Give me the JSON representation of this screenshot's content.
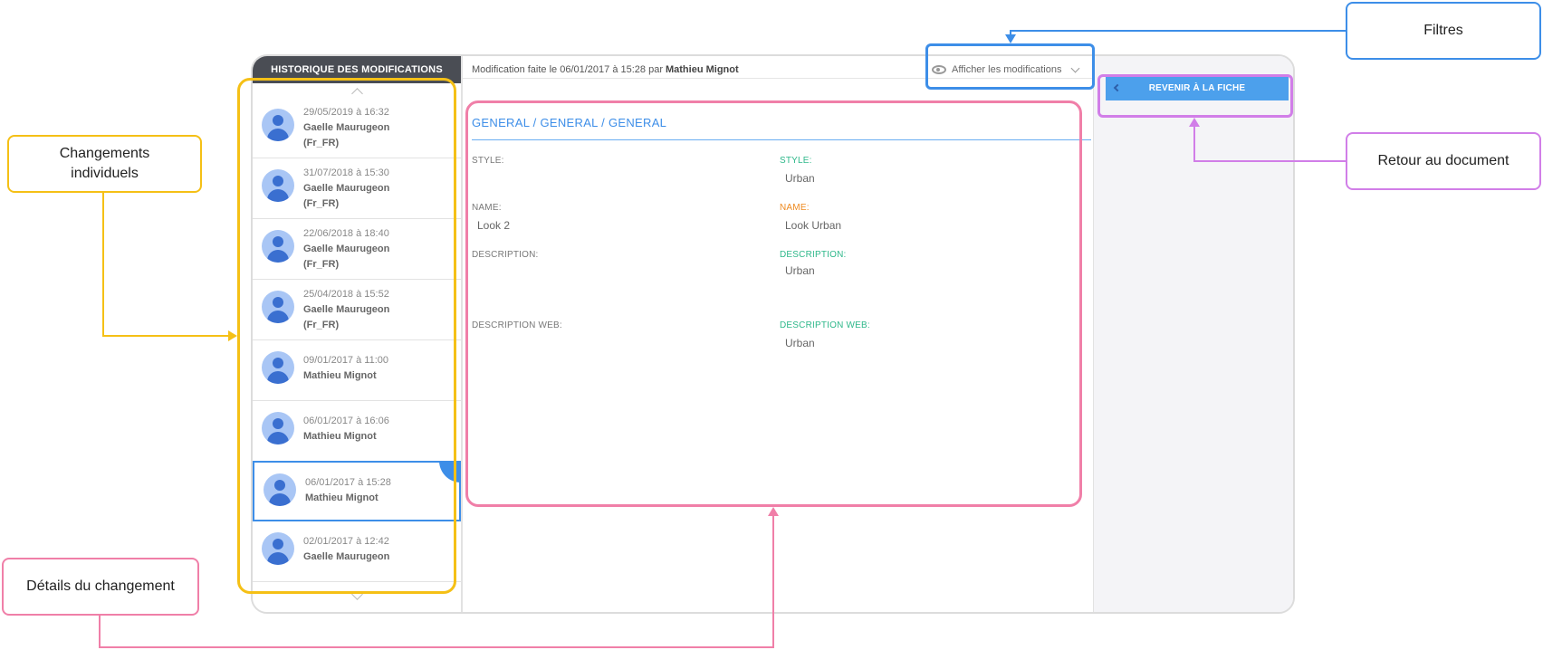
{
  "panel": {
    "title": "HISTORIQUE DES MODIFICATIONS",
    "history": [
      {
        "date": "29/05/2019 à 16:32",
        "user": "Gaelle Maurugeon",
        "locale": "(Fr_FR)"
      },
      {
        "date": "31/07/2018 à 15:30",
        "user": "Gaelle Maurugeon",
        "locale": "(Fr_FR)"
      },
      {
        "date": "22/06/2018 à 18:40",
        "user": "Gaelle Maurugeon",
        "locale": "(Fr_FR)"
      },
      {
        "date": "25/04/2018 à 15:52",
        "user": "Gaelle Maurugeon",
        "locale": "(Fr_FR)"
      },
      {
        "date": "09/01/2017 à 11:00",
        "user": "Mathieu Mignot"
      },
      {
        "date": "06/01/2017 à 16:06",
        "user": "Mathieu Mignot"
      },
      {
        "date": "06/01/2017 à 15:28",
        "user": "Mathieu Mignot",
        "selected": true
      },
      {
        "date": "02/01/2017 à 12:42",
        "user": "Gaelle Maurugeon"
      }
    ]
  },
  "topbar": {
    "modification_prefix": "Modification faite le 06/01/2017 à 15:28 par",
    "modification_user": "Mathieu Mignot",
    "filter_label": "Afficher les modifications"
  },
  "back_button": {
    "label": "REVENIR À LA FICHE"
  },
  "detail": {
    "section_title": "GENERAL / GENERAL / GENERAL",
    "fields": [
      {
        "left_label": "STYLE:",
        "left_value": "",
        "right_label": "STYLE:",
        "right_value": "Urban",
        "right_status": "added"
      },
      {
        "left_label": "NAME:",
        "left_value": "Look 2",
        "right_label": "NAME:",
        "right_value": "Look Urban",
        "right_status": "modified"
      },
      {
        "left_label": "DESCRIPTION:",
        "left_value": "",
        "right_label": "DESCRIPTION:",
        "right_value": "Urban",
        "right_status": "added"
      },
      {
        "left_label": "DESCRIPTION WEB:",
        "left_value": "",
        "right_label": "DESCRIPTION WEB:",
        "right_value": "Urban",
        "right_status": "added"
      }
    ]
  },
  "annotations": {
    "changements": "Changements individuels",
    "details": "Détails du changement",
    "filtres": "Filtres",
    "retour": "Retour au document"
  },
  "colors": {
    "yellow": "#f5c016",
    "pink": "#f07fa8",
    "blue": "#3d8ee8",
    "violet": "#d17ee8",
    "added": "#2eb88a",
    "modified": "#ee8a1f"
  }
}
